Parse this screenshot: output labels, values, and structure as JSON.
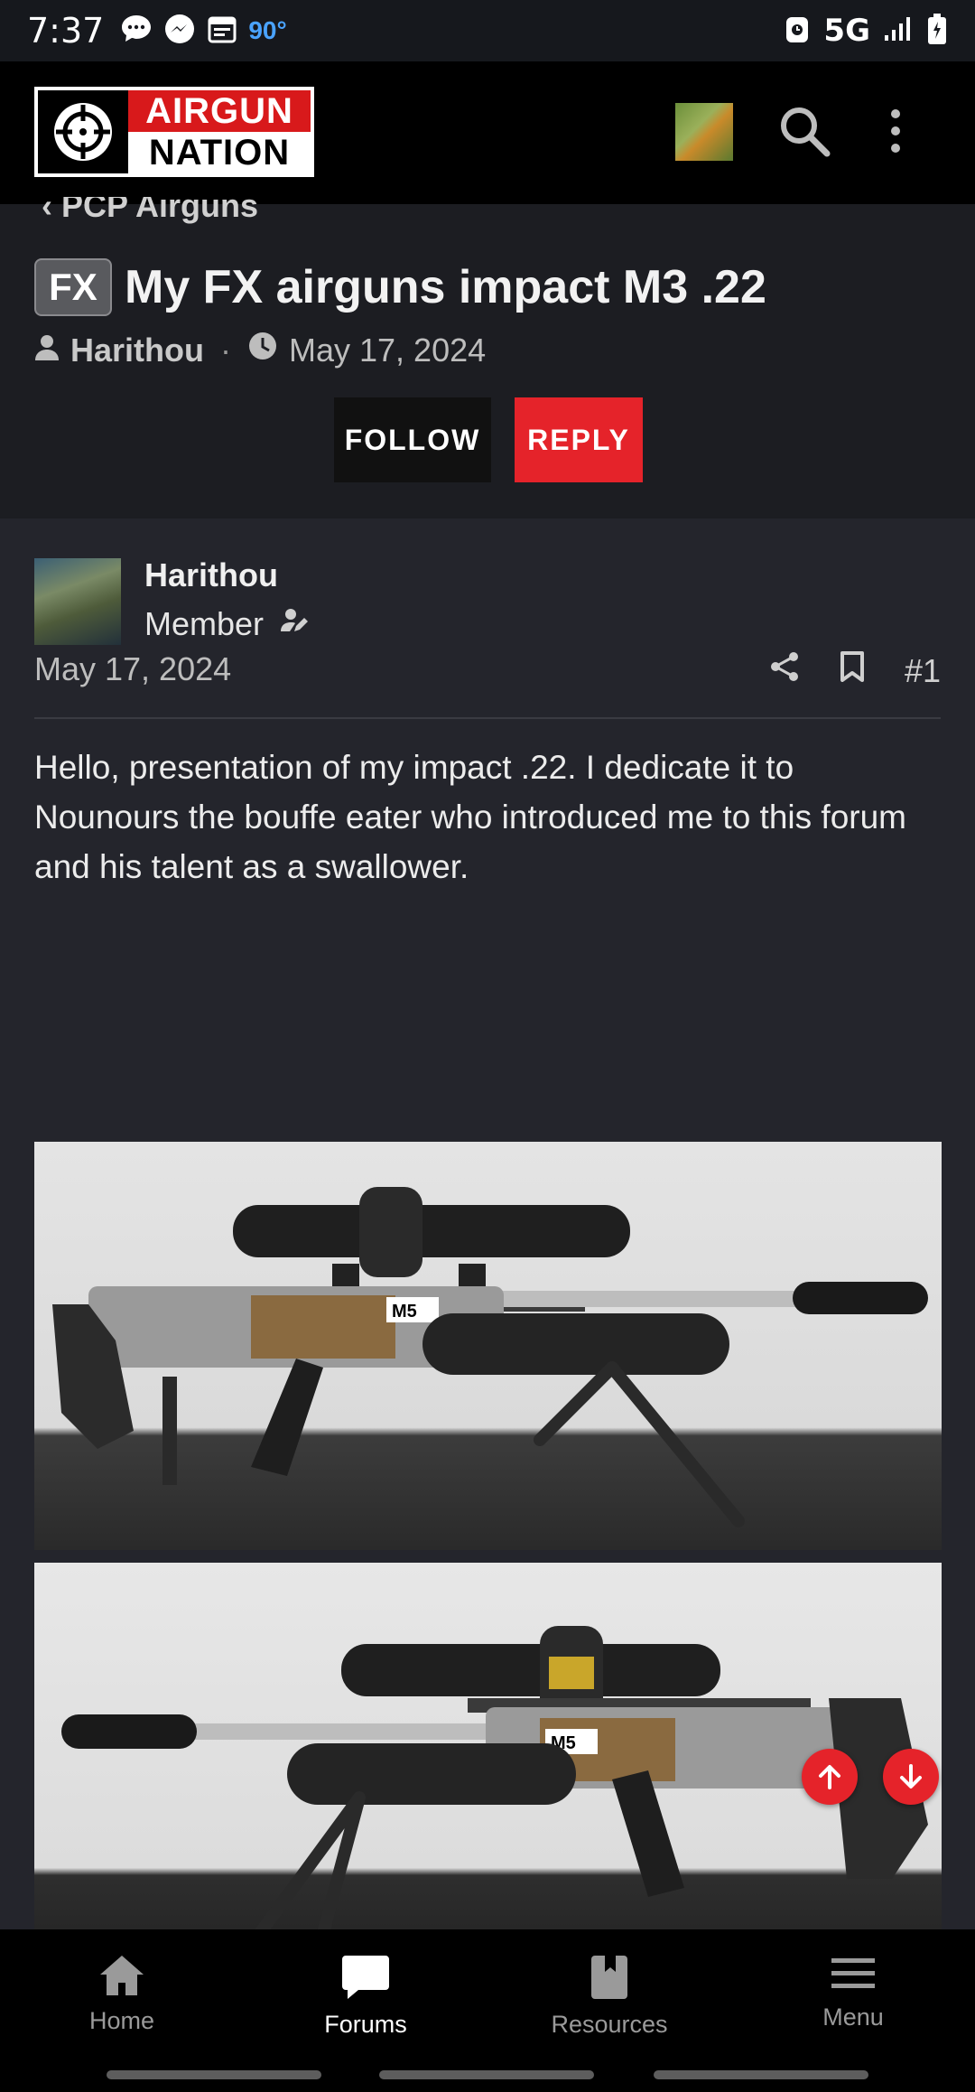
{
  "status_bar": {
    "time": "7:37",
    "temperature": "90°",
    "network": "5G",
    "icons": [
      "messages-icon",
      "messenger-icon",
      "calendar-icon",
      "alarm-icon",
      "signal-icon",
      "battery-icon"
    ]
  },
  "header": {
    "logo_top": "AIRGUN",
    "logo_bottom": "NATION",
    "icons": [
      "avatar",
      "search-icon",
      "more-vertical-icon"
    ]
  },
  "thread": {
    "breadcrumb": "PCP Airguns",
    "prefix": "FX",
    "title": "My FX airguns impact M3 .22",
    "author": "Harithou",
    "date": "May 17, 2024",
    "follow_label": "FOLLOW",
    "reply_label": "REPLY"
  },
  "post": {
    "author": "Harithou",
    "role": "Member",
    "date": "May 17, 2024",
    "post_number": "#1",
    "body": "Hello, presentation of my impact .22. I dedicate it to Nounours the bouffe eater who introduced me to this forum and his talent as a swallower.",
    "image_labels": [
      "M5",
      "M5"
    ]
  },
  "bottom_nav": {
    "items": [
      {
        "label": "Home",
        "icon": "home-icon",
        "active": false
      },
      {
        "label": "Forums",
        "icon": "forums-icon",
        "active": true
      },
      {
        "label": "Resources",
        "icon": "book-icon",
        "active": false
      },
      {
        "label": "Menu",
        "icon": "menu-icon",
        "active": false
      }
    ]
  },
  "colors": {
    "accent": "#e5232a",
    "background": "#24252c",
    "header_bg": "#000000",
    "thread_head_bg": "#1c1d22"
  }
}
